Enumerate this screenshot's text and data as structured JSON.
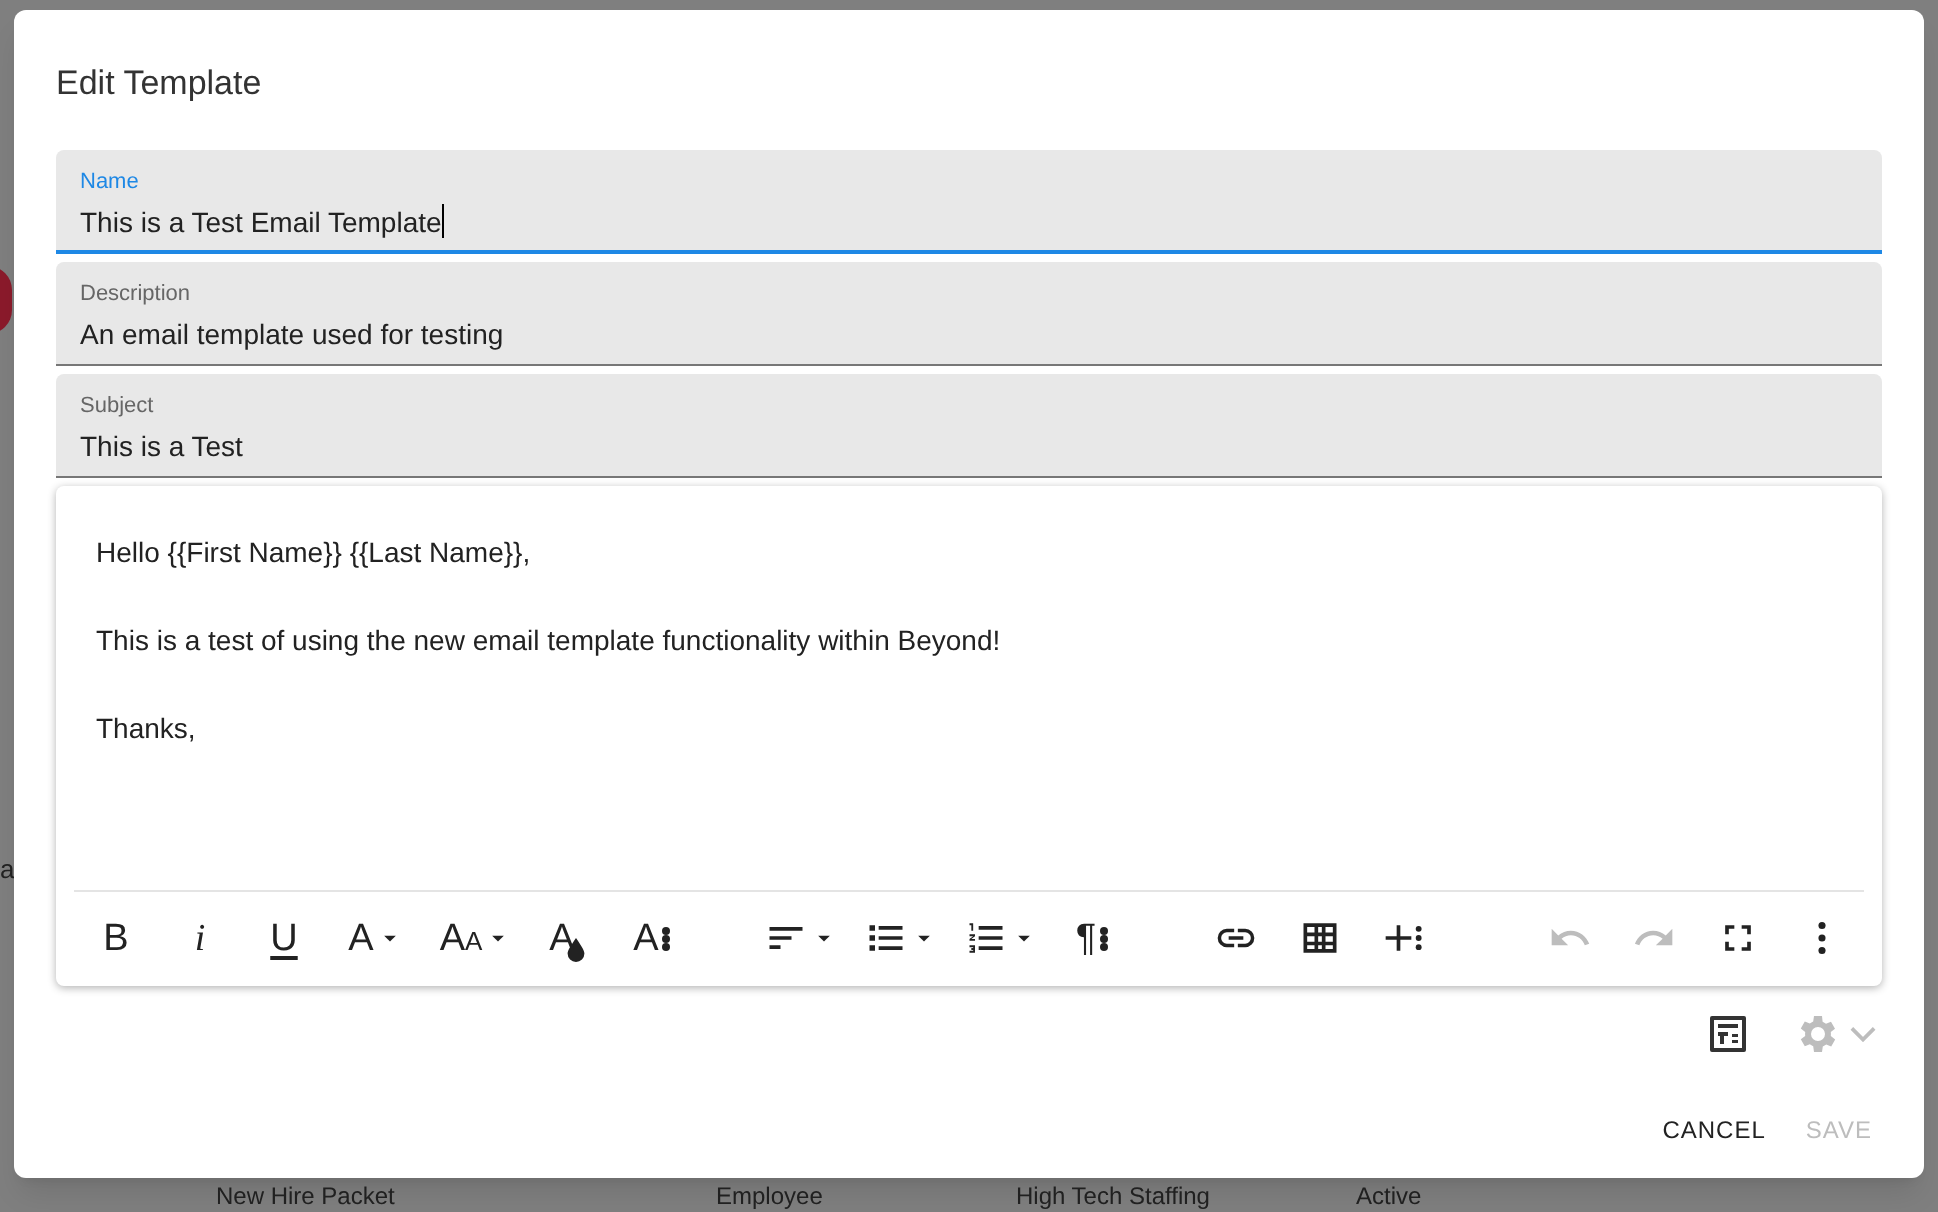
{
  "background": {
    "side_text": "a",
    "row": [
      "New Hire Packet",
      "Employee",
      "High Tech Staffing",
      "Active"
    ]
  },
  "dialog": {
    "title": "Edit Template",
    "fields": [
      {
        "label": "Name",
        "value": "This is a Test Email Template",
        "focused": true
      },
      {
        "label": "Description",
        "value": "An email template used for testing",
        "focused": false
      },
      {
        "label": "Subject",
        "value": "This is a Test",
        "focused": false
      }
    ],
    "editor": {
      "paragraphs": [
        "Hello {{First Name}} {{Last Name}},",
        "This is a test of using the new email template functionality within Beyond!",
        "Thanks,"
      ],
      "toolbar": [
        [
          {
            "kind": "letter",
            "label": "B",
            "dropdown": false,
            "disabled": false
          },
          {
            "kind": "italic",
            "label": "i",
            "dropdown": false,
            "disabled": false
          },
          {
            "kind": "underline",
            "label": "U",
            "dropdown": false,
            "disabled": false
          },
          {
            "kind": "letter",
            "label": "A",
            "dropdown": true,
            "disabled": false
          },
          {
            "kind": "size",
            "label": "AA",
            "dropdown": true,
            "disabled": false
          },
          {
            "kind": "color",
            "label": "A",
            "dropdown": false,
            "disabled": false
          },
          {
            "kind": "letterdots",
            "label": "A",
            "dropdown": false,
            "disabled": false
          }
        ],
        [
          {
            "kind": "align",
            "dropdown": true,
            "disabled": false
          },
          {
            "kind": "bullets",
            "dropdown": true,
            "disabled": false
          },
          {
            "kind": "numbered",
            "dropdown": true,
            "disabled": false
          },
          {
            "kind": "letterdots",
            "label": "¶",
            "dropdown": false,
            "disabled": false
          }
        ],
        [
          {
            "kind": "link",
            "dropdown": false,
            "disabled": false
          },
          {
            "kind": "table",
            "dropdown": false,
            "disabled": false
          },
          {
            "kind": "plus",
            "dropdown": false,
            "disabled": false
          }
        ],
        [
          {
            "kind": "undo",
            "dropdown": false,
            "disabled": true
          },
          {
            "kind": "redo",
            "dropdown": false,
            "disabled": true
          },
          {
            "kind": "fullscreen",
            "dropdown": false,
            "disabled": false
          },
          {
            "kind": "more",
            "dropdown": false,
            "disabled": false
          }
        ]
      ]
    },
    "actions": [
      {
        "label": "CANCEL",
        "disabled": false
      },
      {
        "label": "SAVE",
        "disabled": true
      }
    ]
  }
}
